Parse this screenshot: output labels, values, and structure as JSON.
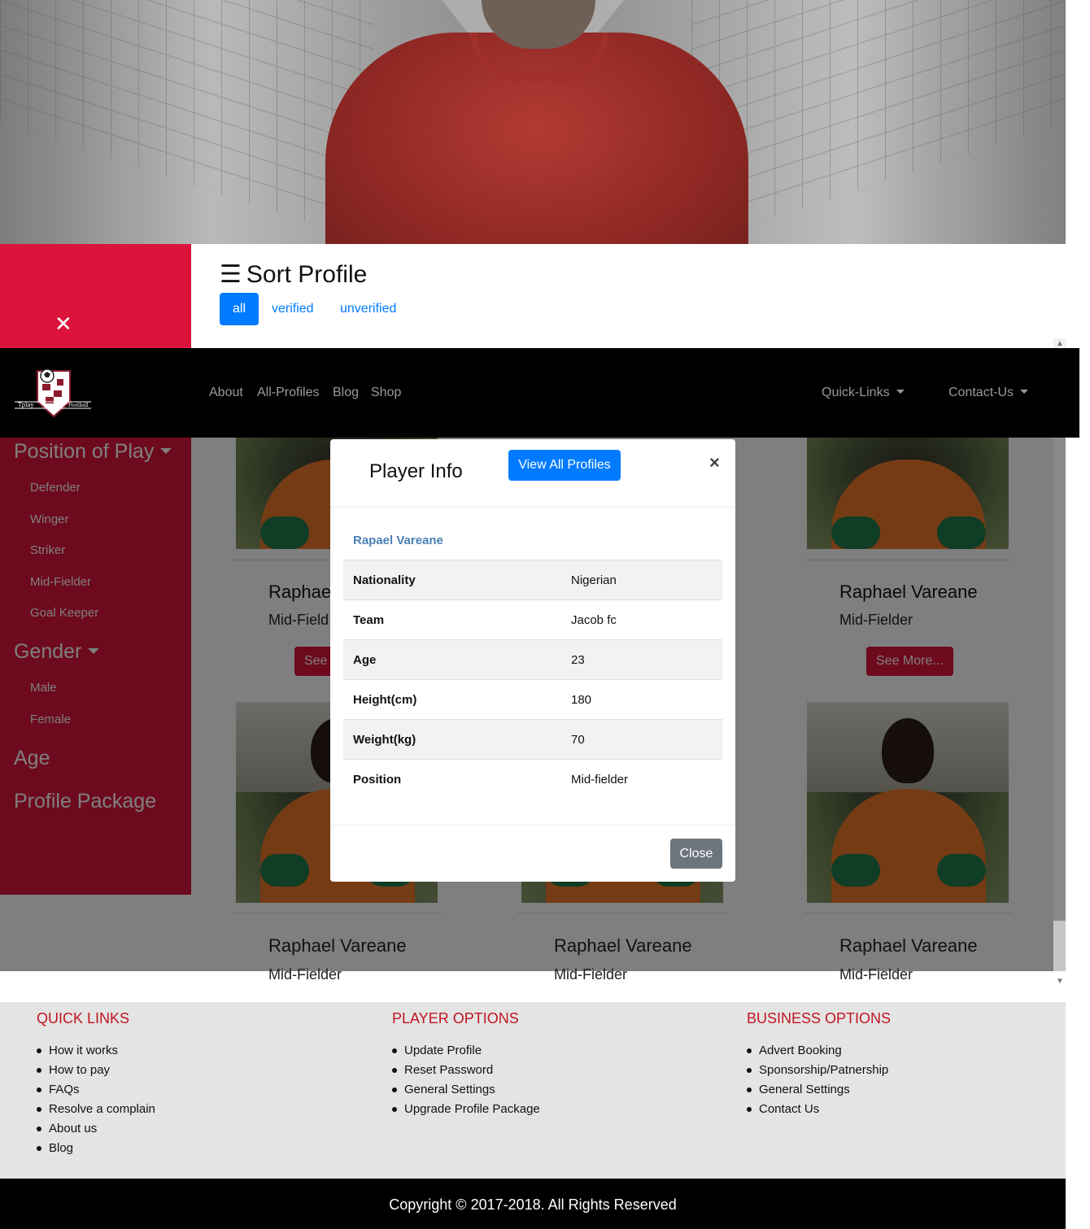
{
  "sort": {
    "title": "Sort Profile",
    "menu_glyph": "☰",
    "close_glyph": "✕",
    "filters": [
      "all",
      "verified",
      "unverified"
    ]
  },
  "navbar": {
    "logo_text_left": "Tplay",
    "logo_text_right": "Football",
    "links": [
      "About",
      "All-Profiles",
      "Blog",
      "Shop"
    ],
    "quick_links": "Quick-Links",
    "contact_us": "Contact-Us"
  },
  "sidebar": {
    "position_heading": "Position of Play",
    "positions": [
      "Defender",
      "Winger",
      "Striker",
      "Mid-Fielder",
      "Goal Keeper"
    ],
    "gender_heading": "Gender",
    "genders": [
      "Male",
      "Female"
    ],
    "age_heading": "Age",
    "package_heading": "Profile Package"
  },
  "cards": {
    "name": "Raphael Vareane",
    "name_partial": "Raphae",
    "position": "Mid-Fielder",
    "position_partial": "Mid-Field",
    "see_more": "See More...",
    "see_partial": "See"
  },
  "modal": {
    "title": "Player Info",
    "view_all": "View All Profiles",
    "close_x": "×",
    "player_name": "Rapael Vareane",
    "rows": [
      {
        "label": "Nationality",
        "value": "Nigerian"
      },
      {
        "label": "Team",
        "value": "Jacob fc"
      },
      {
        "label": "Age",
        "value": "23"
      },
      {
        "label": "Height(cm)",
        "value": "180"
      },
      {
        "label": "Weight(kg)",
        "value": "70"
      },
      {
        "label": "Position",
        "value": "Mid-fielder"
      }
    ],
    "close_button": "Close"
  },
  "footer": {
    "quick_links": {
      "heading": "QUICK LINKS",
      "items": [
        "How it works",
        "How to pay",
        "FAQs",
        "Resolve a complain",
        "About us",
        "Blog"
      ]
    },
    "player_options": {
      "heading": "PLAYER OPTIONS",
      "items": [
        "Update Profile",
        "Reset Password",
        "General Settings",
        "Upgrade Profile Package"
      ]
    },
    "business_options": {
      "heading": "BUSINESS OPTIONS",
      "items": [
        "Advert Booking",
        "Sponsorship/Patnership",
        "General Settings",
        "Contact Us"
      ]
    },
    "copyright": "Copyright © 2017-2018. All Rights Reserved"
  },
  "colors": {
    "brand_red": "#dc143c",
    "primary_blue": "#007bff",
    "footer_heading_red": "#c0161f",
    "navbar_bg": "#000000"
  }
}
